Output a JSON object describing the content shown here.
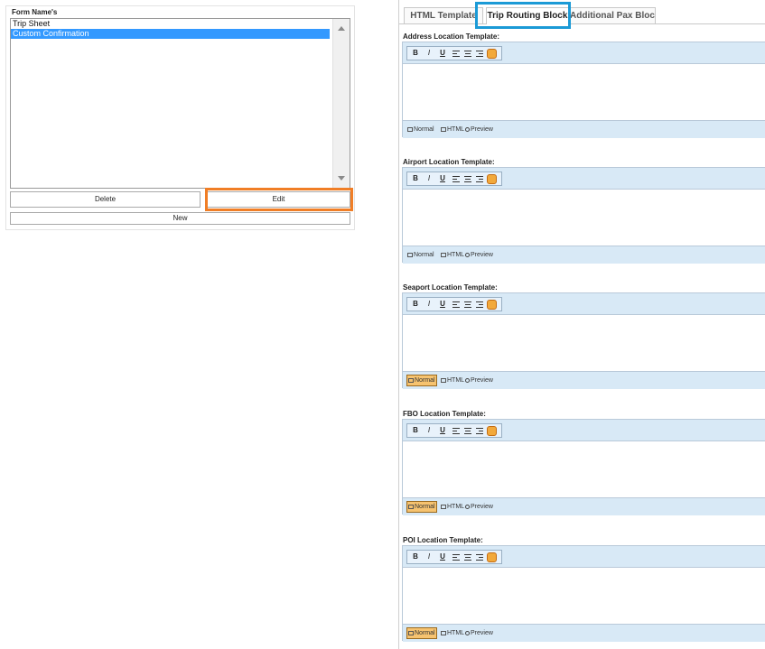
{
  "forms_panel": {
    "legend": "Form Name's",
    "items": [
      "Trip Sheet",
      "Custom Confirmation"
    ],
    "selected_index": 1,
    "buttons": {
      "delete": "Delete",
      "edit": "Edit",
      "new": "New"
    }
  },
  "tabs": [
    {
      "label": "HTML Template",
      "active": false
    },
    {
      "label": "Trip Routing Block",
      "active": true
    },
    {
      "label": "Additional Pax Block",
      "active": false
    }
  ],
  "toolbar": {
    "bold": "B",
    "italic": "I",
    "underline": "U",
    "icons": [
      "align-left-icon",
      "align-center-icon",
      "align-right-icon",
      "eraser-icon"
    ]
  },
  "modes": {
    "normal": "Normal",
    "html": "HTML",
    "preview": "Preview"
  },
  "sections": [
    {
      "title": "Address Location Template:",
      "active_mode": "none"
    },
    {
      "title": "Airport Location Template:",
      "active_mode": "none"
    },
    {
      "title": "Seaport Location Template:",
      "active_mode": "normal"
    },
    {
      "title": "FBO Location Template:",
      "active_mode": "normal"
    },
    {
      "title": "POI Location Template:",
      "active_mode": "normal"
    }
  ],
  "colors": {
    "edit_highlight": "#f07e26",
    "tab_highlight": "#1b9ad6",
    "selection": "#3399ff",
    "toolbar_bg": "#d8e9f6",
    "active_mode_bg": "#f6c370"
  }
}
